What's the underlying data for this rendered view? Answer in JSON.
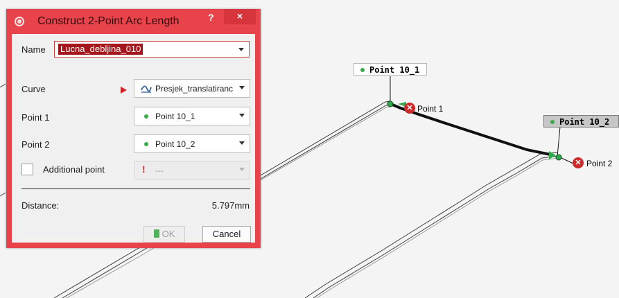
{
  "dialog": {
    "title": "Construct 2-Point Arc Length",
    "help_label": "?",
    "close_label": "×",
    "name_label": "Name",
    "name_value": "Lucna_debljina_010",
    "curve_label": "Curve",
    "curve_value": "Presjek_translatiranc",
    "point1_label": "Point 1",
    "point1_value": "Point 10_1",
    "point2_label": "Point 2",
    "point2_value": "Point 10_2",
    "additional_label": "Additional point",
    "additional_value": "---",
    "distance_label": "Distance:",
    "distance_value": "5.797mm",
    "ok_label": "OK",
    "cancel_label": "Cancel"
  },
  "viewport": {
    "label_point_10_1": "Point 10_1",
    "label_point_10_2": "Point 10_2",
    "marker_point1": "Point 1",
    "marker_point2": "Point 2",
    "err_glyph": "✕"
  },
  "colors": {
    "dialog_frame": "#e8434a",
    "selection": "#a4161b",
    "point_green": "#3daa4a",
    "error_red": "#cc2a2a"
  },
  "icons": {
    "title": "construct-icon",
    "curve": "curve-icon",
    "point": "point-dot-icon",
    "warning": "exclamation-icon",
    "ok": "ok-icon"
  }
}
